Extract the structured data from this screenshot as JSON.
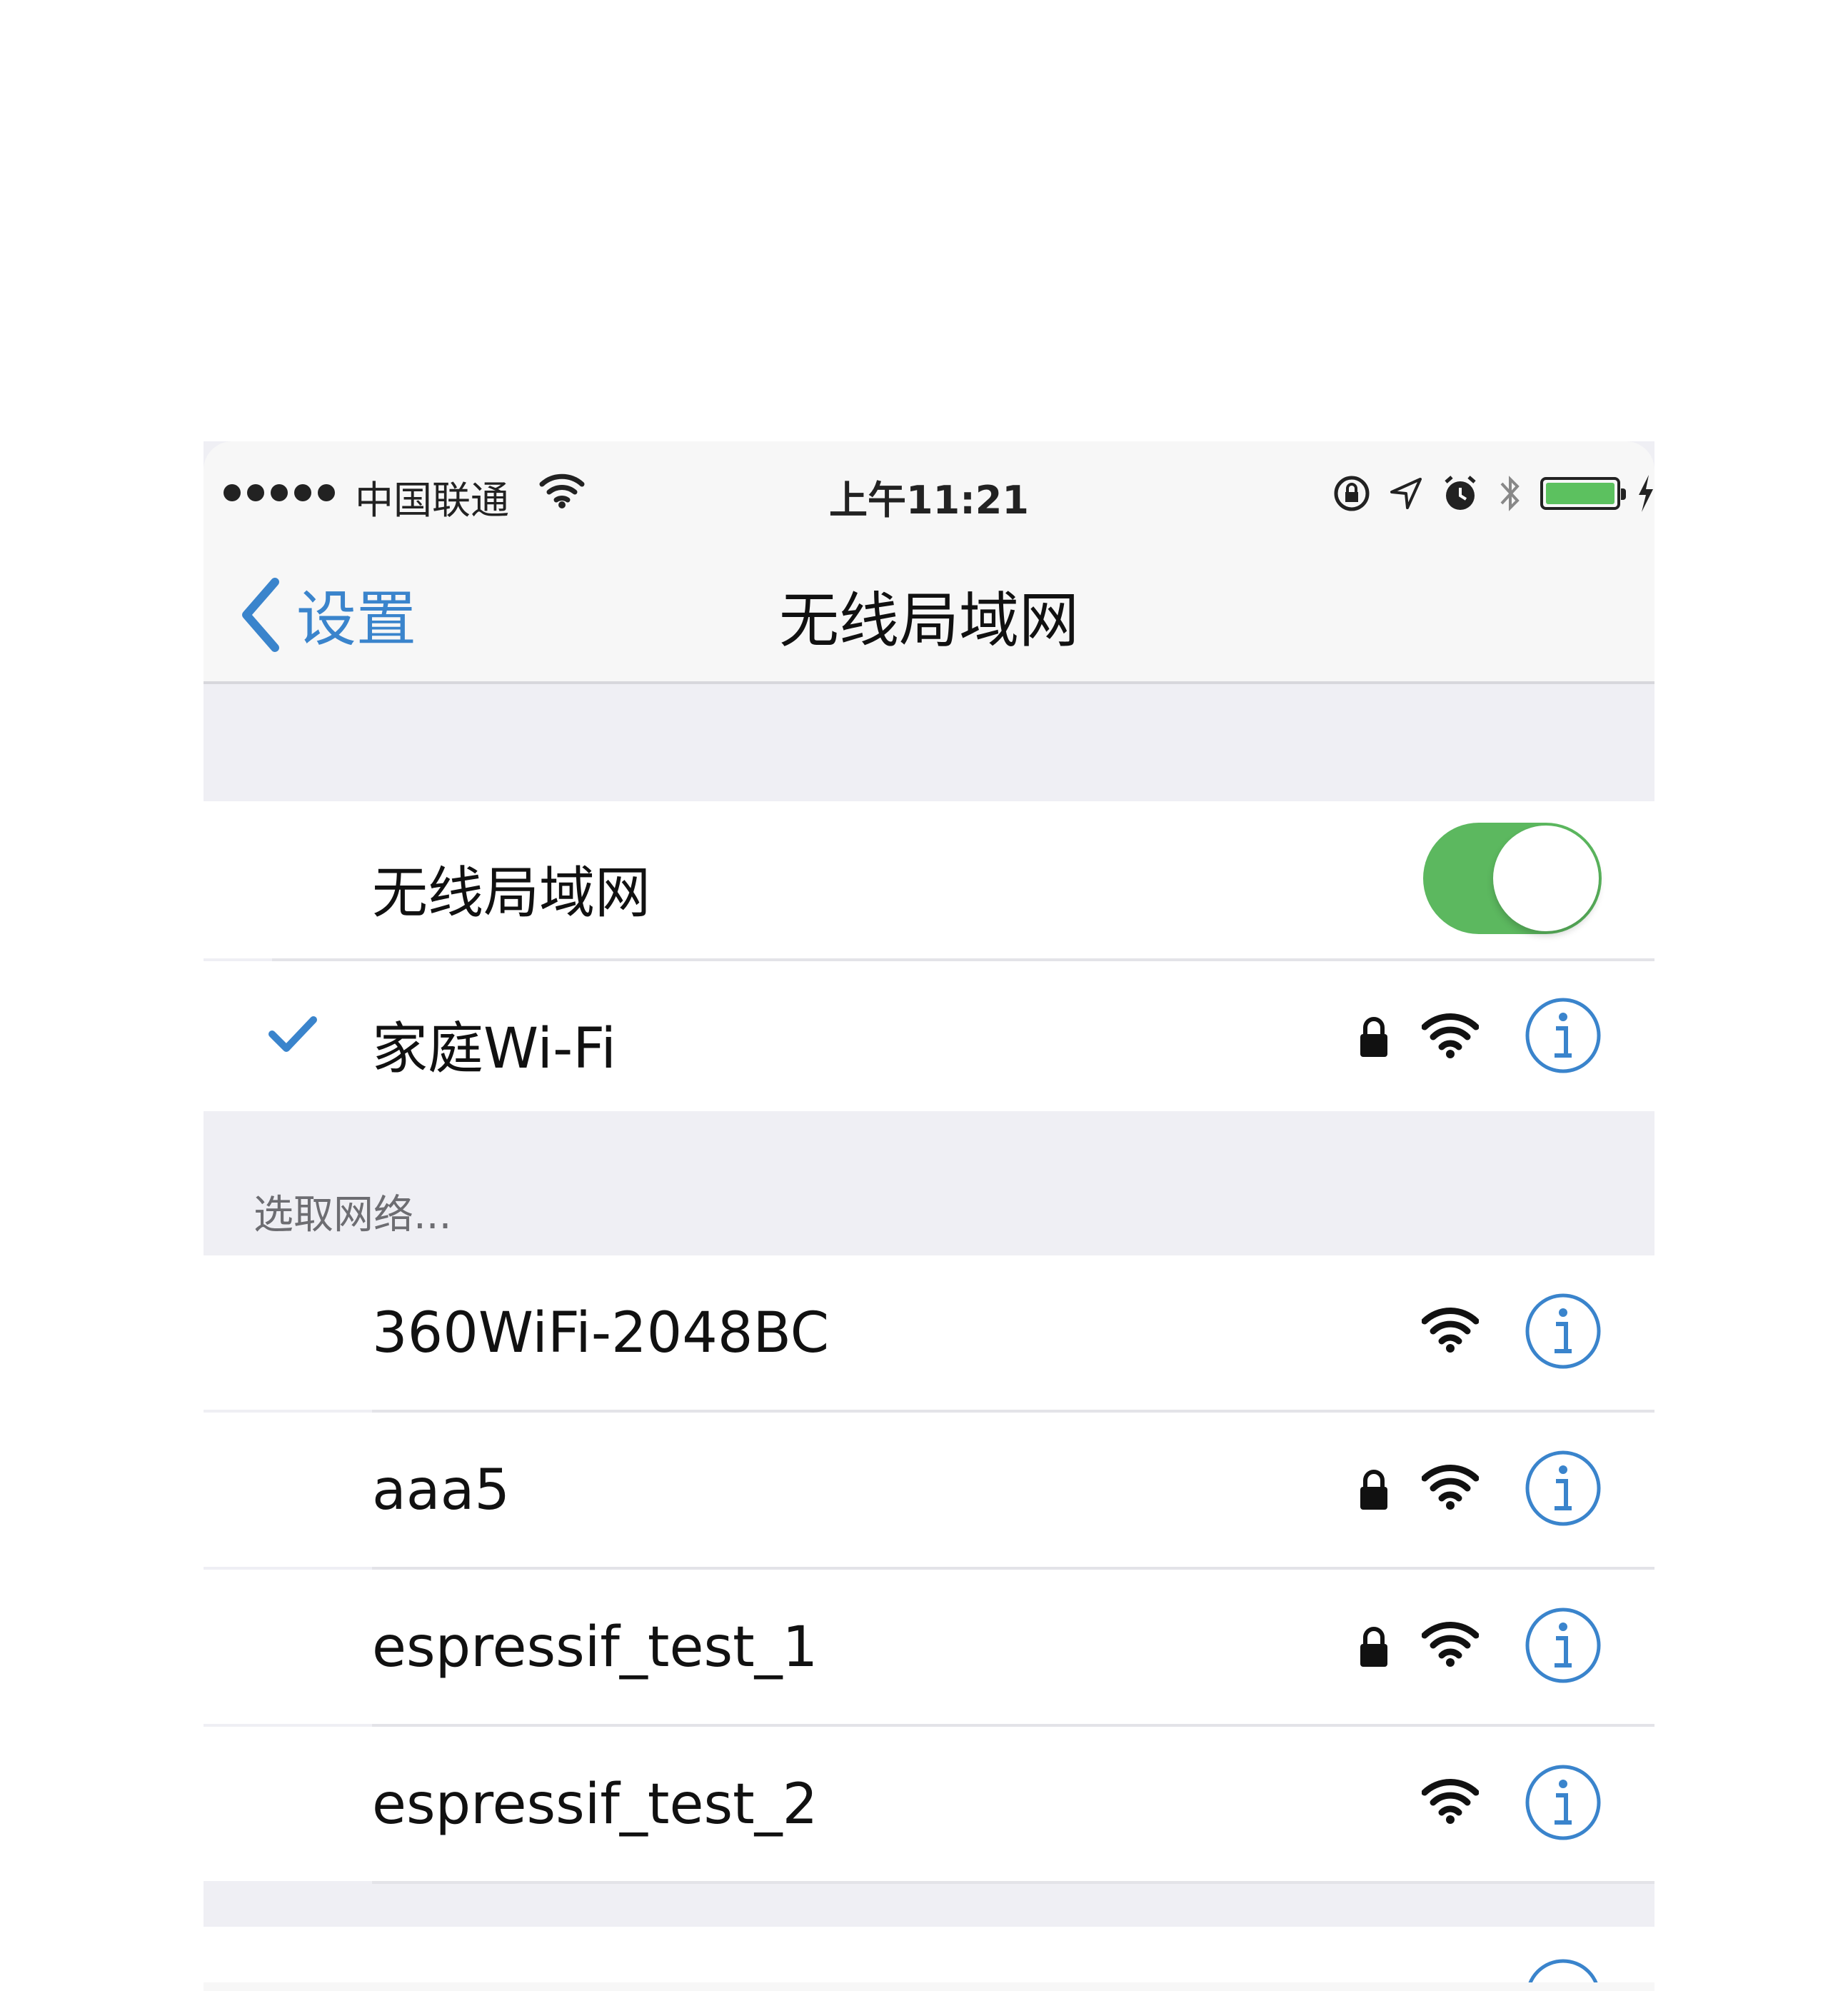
{
  "status_bar": {
    "carrier": "中国联通",
    "time": "上午11:21",
    "icons": [
      "signal-dots",
      "wifi-icon",
      "orientation-lock-icon",
      "location-icon",
      "alarm-icon",
      "bluetooth-icon",
      "battery-icon",
      "charging-icon"
    ],
    "battery_level": 1.0
  },
  "nav": {
    "back_label": "设置",
    "title": "无线局域网"
  },
  "wifi_toggle": {
    "label": "无线局域网",
    "on": true
  },
  "connected_network": {
    "name": "家庭Wi-Fi",
    "locked": true
  },
  "choose_network_header": "选取网络...",
  "networks": [
    {
      "name": "360WiFi-2048BC",
      "locked": false
    },
    {
      "name": "aaa5",
      "locked": true
    },
    {
      "name": "espressif_test_1",
      "locked": true
    },
    {
      "name": "espressif_test_2",
      "locked": false
    }
  ],
  "colors": {
    "accent": "#3a84cc",
    "toggle_on": "#5cb85f",
    "background": "#efeff4"
  }
}
